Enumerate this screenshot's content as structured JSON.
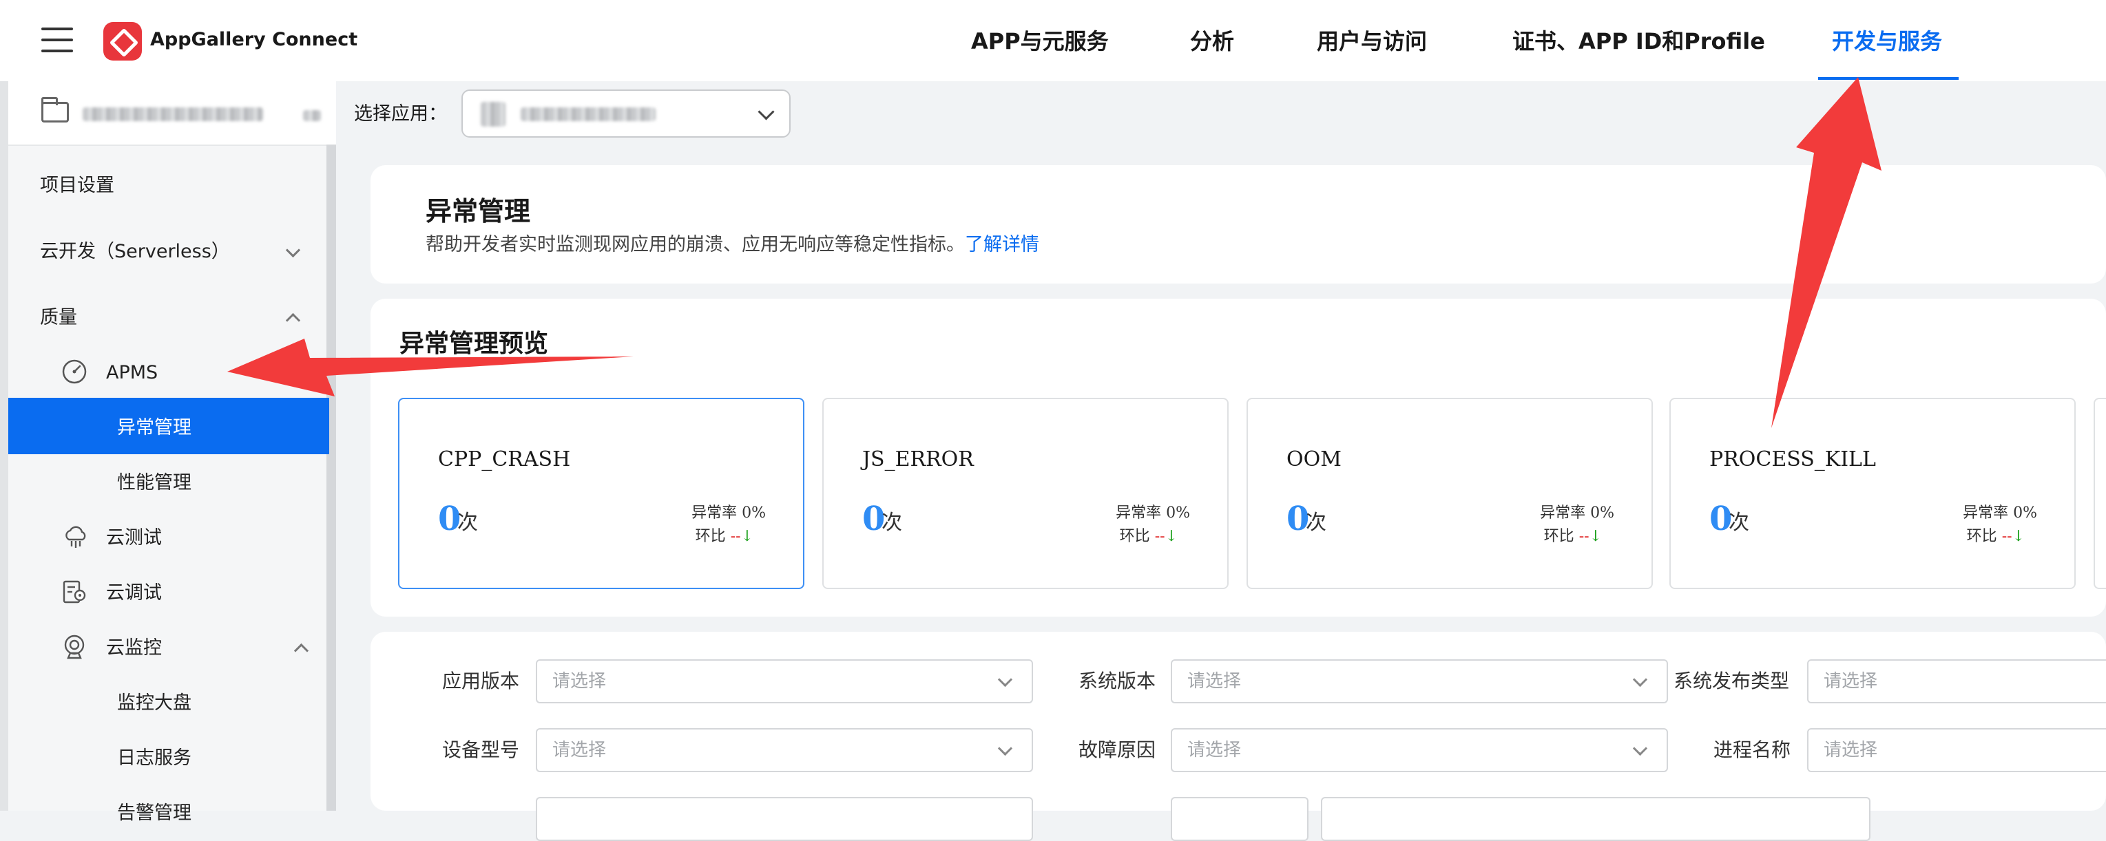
{
  "header": {
    "brand": "AppGallery Connect",
    "nav": [
      {
        "label": "APP与元服务",
        "active": false
      },
      {
        "label": "分析",
        "active": false
      },
      {
        "label": "用户与访问",
        "active": false
      },
      {
        "label": "证书、APP ID和Profile",
        "active": false
      },
      {
        "label": "开发与服务",
        "active": true
      }
    ],
    "accent_color": "#0a6cf0"
  },
  "sidebar": {
    "items": [
      {
        "label": "项目设置"
      },
      {
        "label": "云开发（Serverless）",
        "expanded": false
      },
      {
        "label": "质量",
        "expanded": true
      },
      {
        "label": "APMS",
        "icon": "gauge-icon"
      },
      {
        "label": "异常管理",
        "selected": true
      },
      {
        "label": "性能管理"
      },
      {
        "label": "云测试",
        "icon": "cloud-test-icon"
      },
      {
        "label": "云调试",
        "icon": "cloud-debug-icon"
      },
      {
        "label": "云监控",
        "icon": "camera-icon",
        "expanded": true
      },
      {
        "label": "监控大盘"
      },
      {
        "label": "日志服务"
      },
      {
        "label": "告警管理"
      }
    ]
  },
  "app_selector": {
    "label": "选择应用："
  },
  "page": {
    "title": "异常管理",
    "description": "帮助开发者实时监测现网应用的崩溃、应用无响应等稳定性指标。",
    "learn_more": "了解详情"
  },
  "overview": {
    "title": "异常管理预览",
    "metrics": [
      {
        "name": "CPP_CRASH",
        "count": "0",
        "unit": "次",
        "rate": "异常率 0%",
        "compare_label": "环比",
        "compare_value": "--",
        "compare_arrow": "↓",
        "selected": true
      },
      {
        "name": "JS_ERROR",
        "count": "0",
        "unit": "次",
        "rate": "异常率 0%",
        "compare_label": "环比",
        "compare_value": "--",
        "compare_arrow": "↓",
        "selected": false
      },
      {
        "name": "OOM",
        "count": "0",
        "unit": "次",
        "rate": "异常率 0%",
        "compare_label": "环比",
        "compare_value": "--",
        "compare_arrow": "↓",
        "selected": false
      },
      {
        "name": "PROCESS_KILL",
        "count": "0",
        "unit": "次",
        "rate": "异常率 0%",
        "compare_label": "环比",
        "compare_value": "--",
        "compare_arrow": "↓",
        "selected": false
      }
    ]
  },
  "filters": {
    "placeholder": "请选择",
    "fields": [
      {
        "label": "应用版本"
      },
      {
        "label": "系统版本"
      },
      {
        "label": "系统发布类型"
      },
      {
        "label": "设备型号"
      },
      {
        "label": "故障原因"
      },
      {
        "label": "进程名称"
      }
    ]
  },
  "annotation_color": "#f23b3b"
}
